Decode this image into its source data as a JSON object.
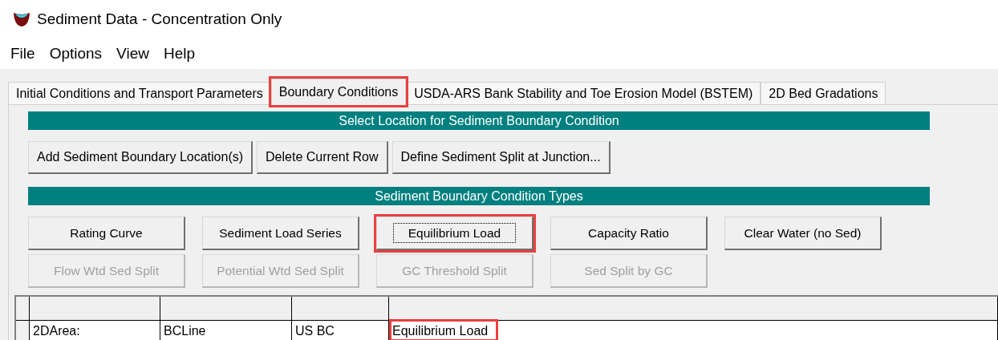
{
  "window": {
    "title": "Sediment Data - Concentration Only"
  },
  "menu": [
    "File",
    "Options",
    "View",
    "Help"
  ],
  "tabs": [
    {
      "label": "Initial Conditions and Transport Parameters",
      "selected": false,
      "highlighted": false
    },
    {
      "label": "Boundary Conditions",
      "selected": true,
      "highlighted": true
    },
    {
      "label": "USDA-ARS Bank Stability and Toe Erosion Model (BSTEM)",
      "selected": false,
      "highlighted": false
    },
    {
      "label": "2D Bed Gradations",
      "selected": false,
      "highlighted": false
    }
  ],
  "location_section": {
    "header": "Select Location for Sediment Boundary Condition",
    "buttons": [
      "Add Sediment Boundary Location(s)",
      "Delete Current Row",
      "Define Sediment Split at Junction..."
    ]
  },
  "types_section": {
    "header": "Sediment Boundary Condition Types",
    "rows": [
      [
        {
          "label": "Rating Curve",
          "disabled": false,
          "focused": false,
          "highlighted": false
        },
        {
          "label": "Sediment Load Series",
          "disabled": false,
          "focused": false,
          "highlighted": false
        },
        {
          "label": "Equilibrium Load",
          "disabled": false,
          "focused": true,
          "highlighted": true
        },
        {
          "label": "Capacity Ratio",
          "disabled": false,
          "focused": false,
          "highlighted": false
        },
        {
          "label": "Clear Water (no Sed)",
          "disabled": false,
          "focused": false,
          "highlighted": false
        }
      ],
      [
        {
          "label": "Flow Wtd Sed Split",
          "disabled": true,
          "focused": false,
          "highlighted": false
        },
        {
          "label": "Potential Wtd Sed Split",
          "disabled": true,
          "focused": false,
          "highlighted": false
        },
        {
          "label": "GC Threshold Split",
          "disabled": true,
          "focused": false,
          "highlighted": false
        },
        {
          "label": "Sed Split by GC",
          "disabled": true,
          "focused": false,
          "highlighted": false
        }
      ]
    ]
  },
  "table": {
    "rows": [
      {
        "cells": [
          {
            "text": "2DArea:",
            "highlighted": false
          },
          {
            "text": "BCLine",
            "highlighted": false
          },
          {
            "text": "US BC",
            "highlighted": false
          },
          {
            "text": "Equilibrium Load",
            "highlighted": true
          }
        ]
      }
    ]
  }
}
